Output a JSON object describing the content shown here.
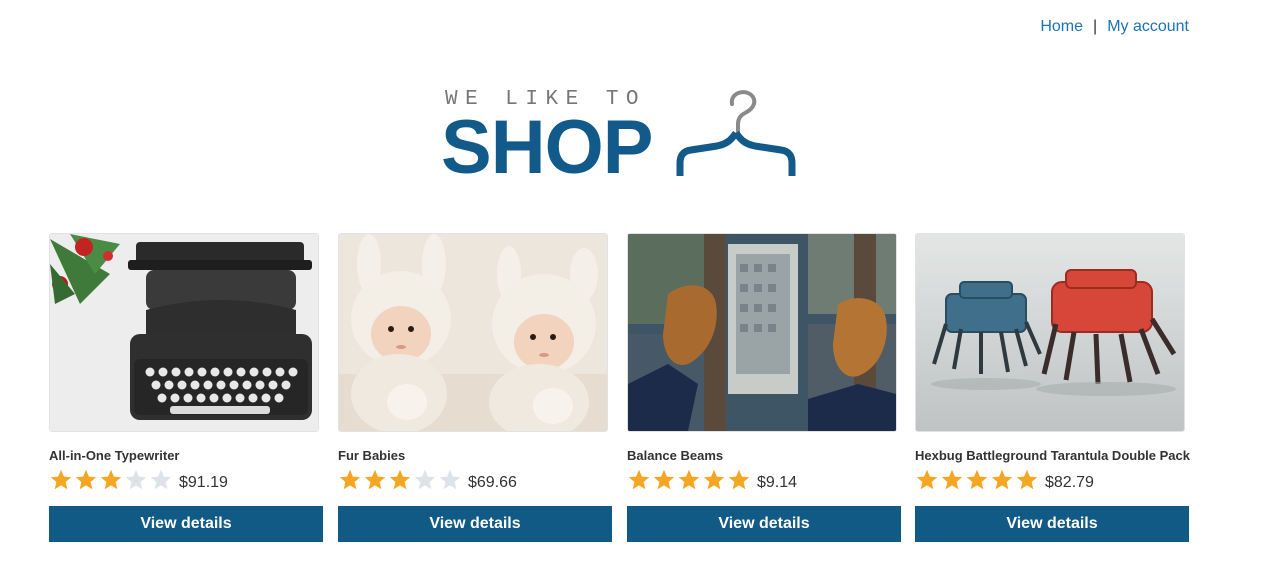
{
  "nav": {
    "home_label": "Home",
    "separator": "|",
    "account_label": "My account"
  },
  "logo": {
    "tagline": "WE LIKE TO",
    "wordmark": "SHOP",
    "icon": "hanger-icon",
    "colors": {
      "wordmark": "#115a8a",
      "tagline": "#777777",
      "hanger_hook": "#8a8a8a"
    }
  },
  "colors": {
    "button_bg": "#115a86",
    "star_filled": "#f5a623",
    "star_empty": "#dde3e8",
    "link": "#1a73b6"
  },
  "products": [
    {
      "title": "All-in-One Typewriter",
      "rating": 3,
      "max_rating": 5,
      "price": "$91.19",
      "button_label": "View details",
      "image": "typewriter-image"
    },
    {
      "title": "Fur Babies",
      "rating": 3,
      "max_rating": 5,
      "price": "$69.66",
      "button_label": "View details",
      "image": "babies-in-bunny-hats-image"
    },
    {
      "title": "Balance Beams",
      "rating": 5,
      "max_rating": 5,
      "price": "$9.14",
      "button_label": "View details",
      "image": "feet-over-city-image"
    },
    {
      "title": "Hexbug Battleground Tarantula Double Pack",
      "rating": 5,
      "max_rating": 5,
      "price": "$82.79",
      "button_label": "View details",
      "image": "robot-spiders-image"
    }
  ]
}
